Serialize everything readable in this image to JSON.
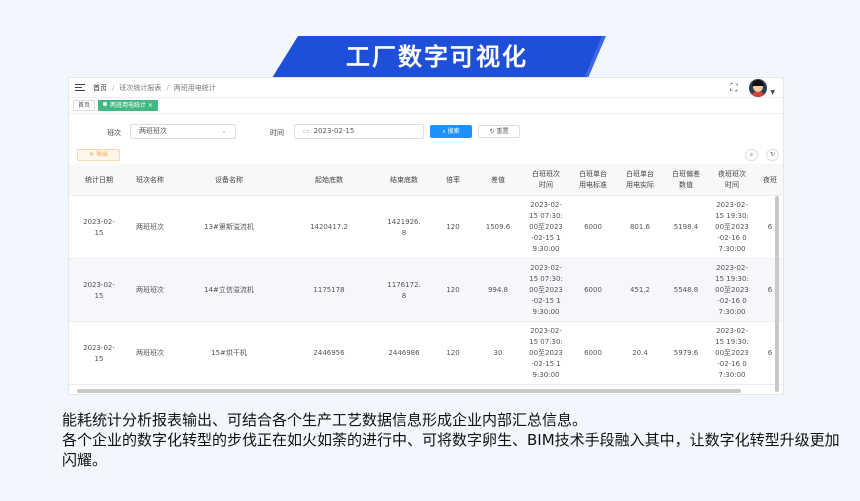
{
  "banner": {
    "title": "工厂数字可视化",
    "color": "#1e4fd8"
  },
  "topbar": {
    "menu_icon": "hamburger-icon",
    "breadcrumb": [
      "首页",
      "班次统计报表",
      "两班用电统计"
    ],
    "fullscreen_icon": "fullscreen-icon"
  },
  "tags": [
    {
      "label": "首页",
      "active": false
    },
    {
      "label": "两班用电统计 ×",
      "active": true
    }
  ],
  "filter": {
    "shift_label": "班次",
    "shift_value": "两班班次",
    "time_label": "时间",
    "time_value": "2023-02-15",
    "search_label": "搜索",
    "reset_label": "重置"
  },
  "toolbar": {
    "export_label": "导出"
  },
  "table": {
    "headers": [
      "统计日期",
      "班次名称",
      "设备名称",
      "起始底数",
      "结束底数",
      "倍率",
      "差值",
      "白班班次时间",
      "白班单台用电标准",
      "白班单台用电实际",
      "白班偏差数值",
      "夜班班次时间",
      "夜班"
    ],
    "rows": [
      [
        "2023-02-15",
        "两班班次",
        "13#第斯溢流机",
        "1420417.2",
        "1421926.8",
        "120",
        "1509.6",
        "2023-02-15 07:30:00至2023-02-15 19:30:00",
        "6000",
        "801.6",
        "5198.4",
        "2023-02-15 19:30:00至2023-02-16 07:30:00",
        "6"
      ],
      [
        "2023-02-15",
        "两班班次",
        "14#立信溢流机",
        "1175178",
        "1176172.8",
        "120",
        "994.8",
        "2023-02-15 07:30:00至2023-02-15 19:30:00",
        "6000",
        "451.2",
        "5548.8",
        "2023-02-15 19:30:00至2023-02-16 07:30:00",
        "6"
      ],
      [
        "2023-02-15",
        "两班班次",
        "15#烘干机",
        "2446956",
        "2446986",
        "120",
        "30",
        "2023-02-15 07:30:00至2023-02-15 19:30:00",
        "6000",
        "20.4",
        "5979.6",
        "2023-02-15 19:30:00至2023-02-16 07:30:00",
        "6"
      ]
    ]
  },
  "description": [
    "能耗统计分析报表输出、可结合各个生产工艺数据信息形成企业内部汇总信息。",
    "各个企业的数字化转型的步伐正在如火如荼的进行中、可将数字卵生、BIM技术手段融入其中，让数字化转型升级更加闪耀。"
  ]
}
